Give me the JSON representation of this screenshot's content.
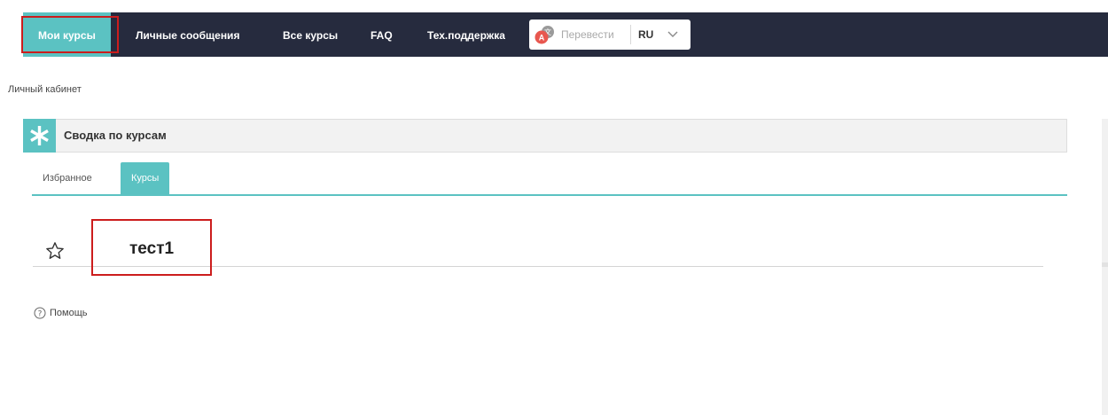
{
  "nav": {
    "items": [
      {
        "label": "Мои курсы"
      },
      {
        "label": "Личные сообщения"
      },
      {
        "label": "Все курсы"
      },
      {
        "label": "FAQ"
      },
      {
        "label": "Тех.поддержка"
      }
    ]
  },
  "translate": {
    "label": "Перевести",
    "language": "RU"
  },
  "breadcrumb": "Личный кабинет",
  "block": {
    "title": "Сводка по курсам"
  },
  "tabs": [
    {
      "label": "Избранное"
    },
    {
      "label": "Курсы"
    }
  ],
  "course": {
    "name": "тест1"
  },
  "help": {
    "label": "Помощь"
  },
  "colors": {
    "navbar": "#262b3e",
    "accent": "#5bc2c2",
    "highlight": "#cc1d1d"
  }
}
